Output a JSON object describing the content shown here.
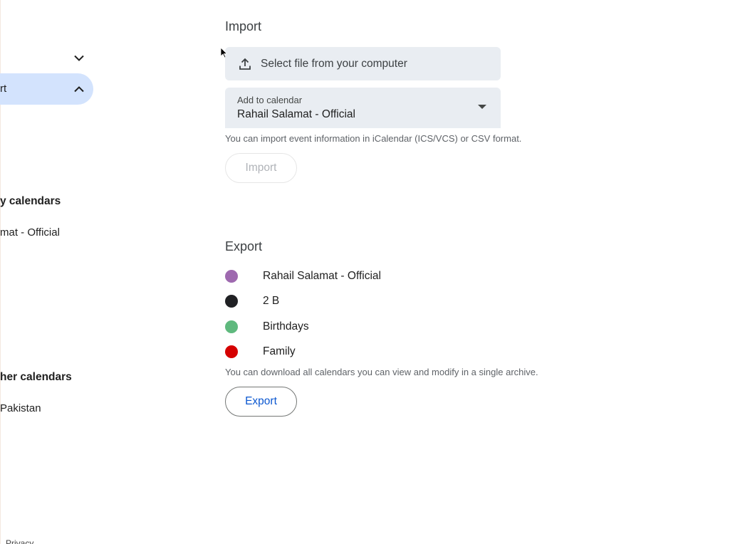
{
  "sidebar": {
    "active_item": "rt",
    "my_calendars_heading": "y calendars",
    "my_calendars": [
      "mat - Official"
    ],
    "other_calendars_heading": "her calendars",
    "other_calendars": [
      "Pakistan"
    ],
    "footer_link": "Privacy"
  },
  "import": {
    "heading": "Import",
    "file_button_label": "Select file from your computer",
    "select_caption": "Add to calendar",
    "select_value": "Rahail Salamat - Official",
    "help_text": "You can import event information in iCalendar (ICS/VCS) or CSV format.",
    "import_button_label": "Import"
  },
  "export": {
    "heading": "Export",
    "calendars": [
      {
        "name": "Rahail Salamat - Official",
        "color": "#9e69af"
      },
      {
        "name": "2 B",
        "color": "#202124"
      },
      {
        "name": "Birthdays",
        "color": "#5fb97e"
      },
      {
        "name": "Family",
        "color": "#d50000"
      }
    ],
    "help_text": "You can download all calendars you can view and modify in a single archive.",
    "export_button_label": "Export"
  },
  "colors": {
    "accent": "#0b57d0",
    "active_bg": "#d3e3fd",
    "field_bg": "#e9edf2"
  }
}
